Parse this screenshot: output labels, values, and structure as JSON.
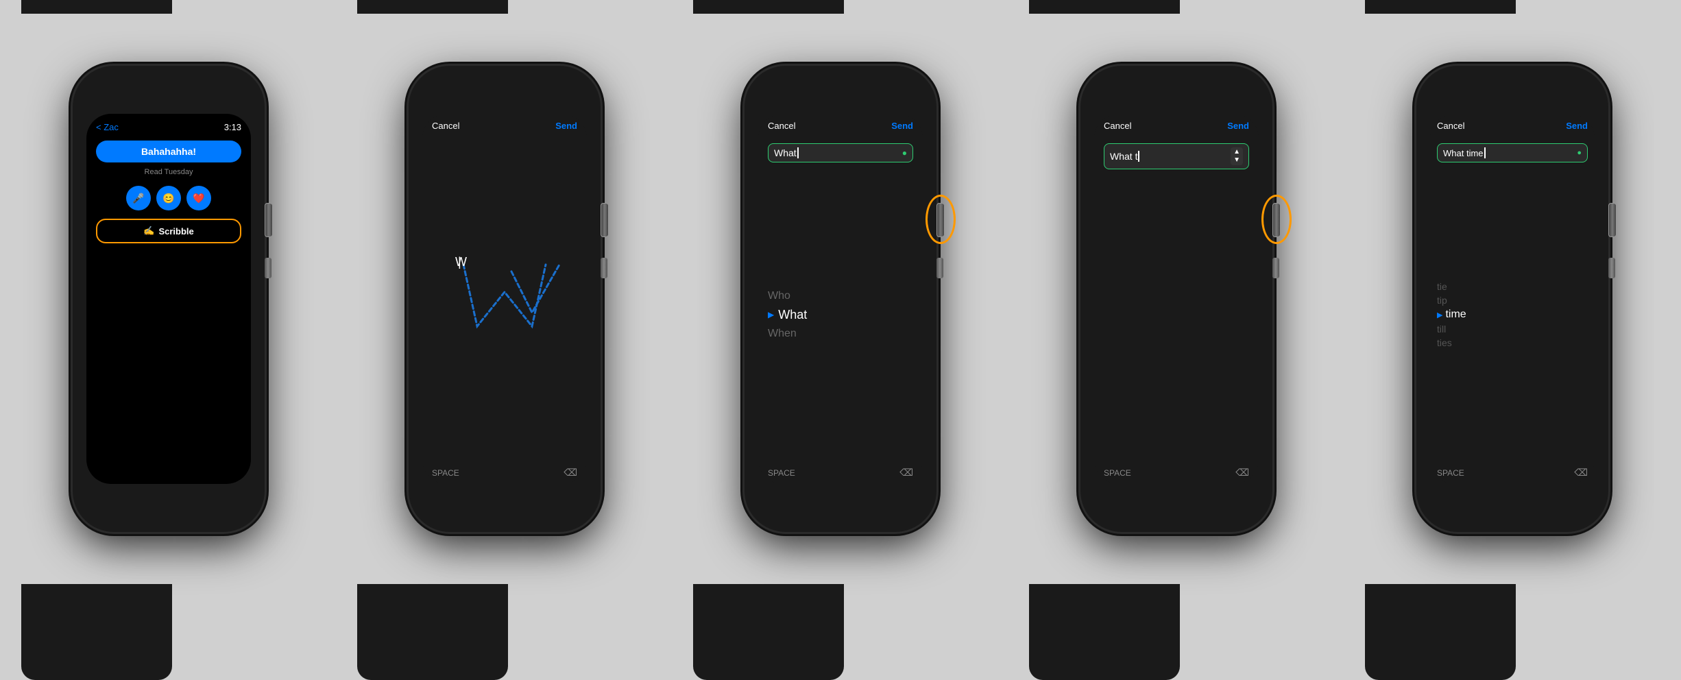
{
  "background": "#d0d0d0",
  "watches": [
    {
      "id": "watch-1",
      "screen": "messages",
      "header": {
        "back_label": "< Zac",
        "time": "3:13"
      },
      "bubble_text": "Bahahahha!",
      "read_text": "Read Tuesday",
      "actions": [
        "mic",
        "emoji",
        "heart"
      ],
      "scribble_button": "Scribble",
      "has_crown_circle": false
    },
    {
      "id": "watch-2",
      "screen": "scribble-draw",
      "cancel_label": "Cancel",
      "send_label": "Send",
      "space_label": "SPACE",
      "drawing": "W",
      "has_crown_circle": false
    },
    {
      "id": "watch-3",
      "screen": "suggestions",
      "cancel_label": "Cancel",
      "send_label": "Send",
      "input_value": "What ",
      "space_label": "SPACE",
      "suggestions": [
        {
          "text": "Who",
          "selected": false
        },
        {
          "text": "What",
          "selected": true
        },
        {
          "text": "When",
          "selected": false
        }
      ],
      "has_crown_circle": true
    },
    {
      "id": "watch-4",
      "screen": "suggestions-2",
      "cancel_label": "Cancel",
      "send_label": "Send",
      "input_value": "What t",
      "space_label": "SPACE",
      "suggestions": [],
      "has_crown_circle": true
    },
    {
      "id": "watch-5",
      "screen": "suggestions-3",
      "cancel_label": "Cancel",
      "send_label": "Send",
      "input_value": "What time",
      "space_label": "SPACE",
      "suggestions": [
        {
          "text": "tie",
          "selected": false
        },
        {
          "text": "tip",
          "selected": false
        },
        {
          "text": "time",
          "selected": true
        },
        {
          "text": "till",
          "selected": false
        },
        {
          "text": "ties",
          "selected": false
        }
      ],
      "has_crown_circle": false
    }
  ],
  "crown_circle_color": "#f90"
}
